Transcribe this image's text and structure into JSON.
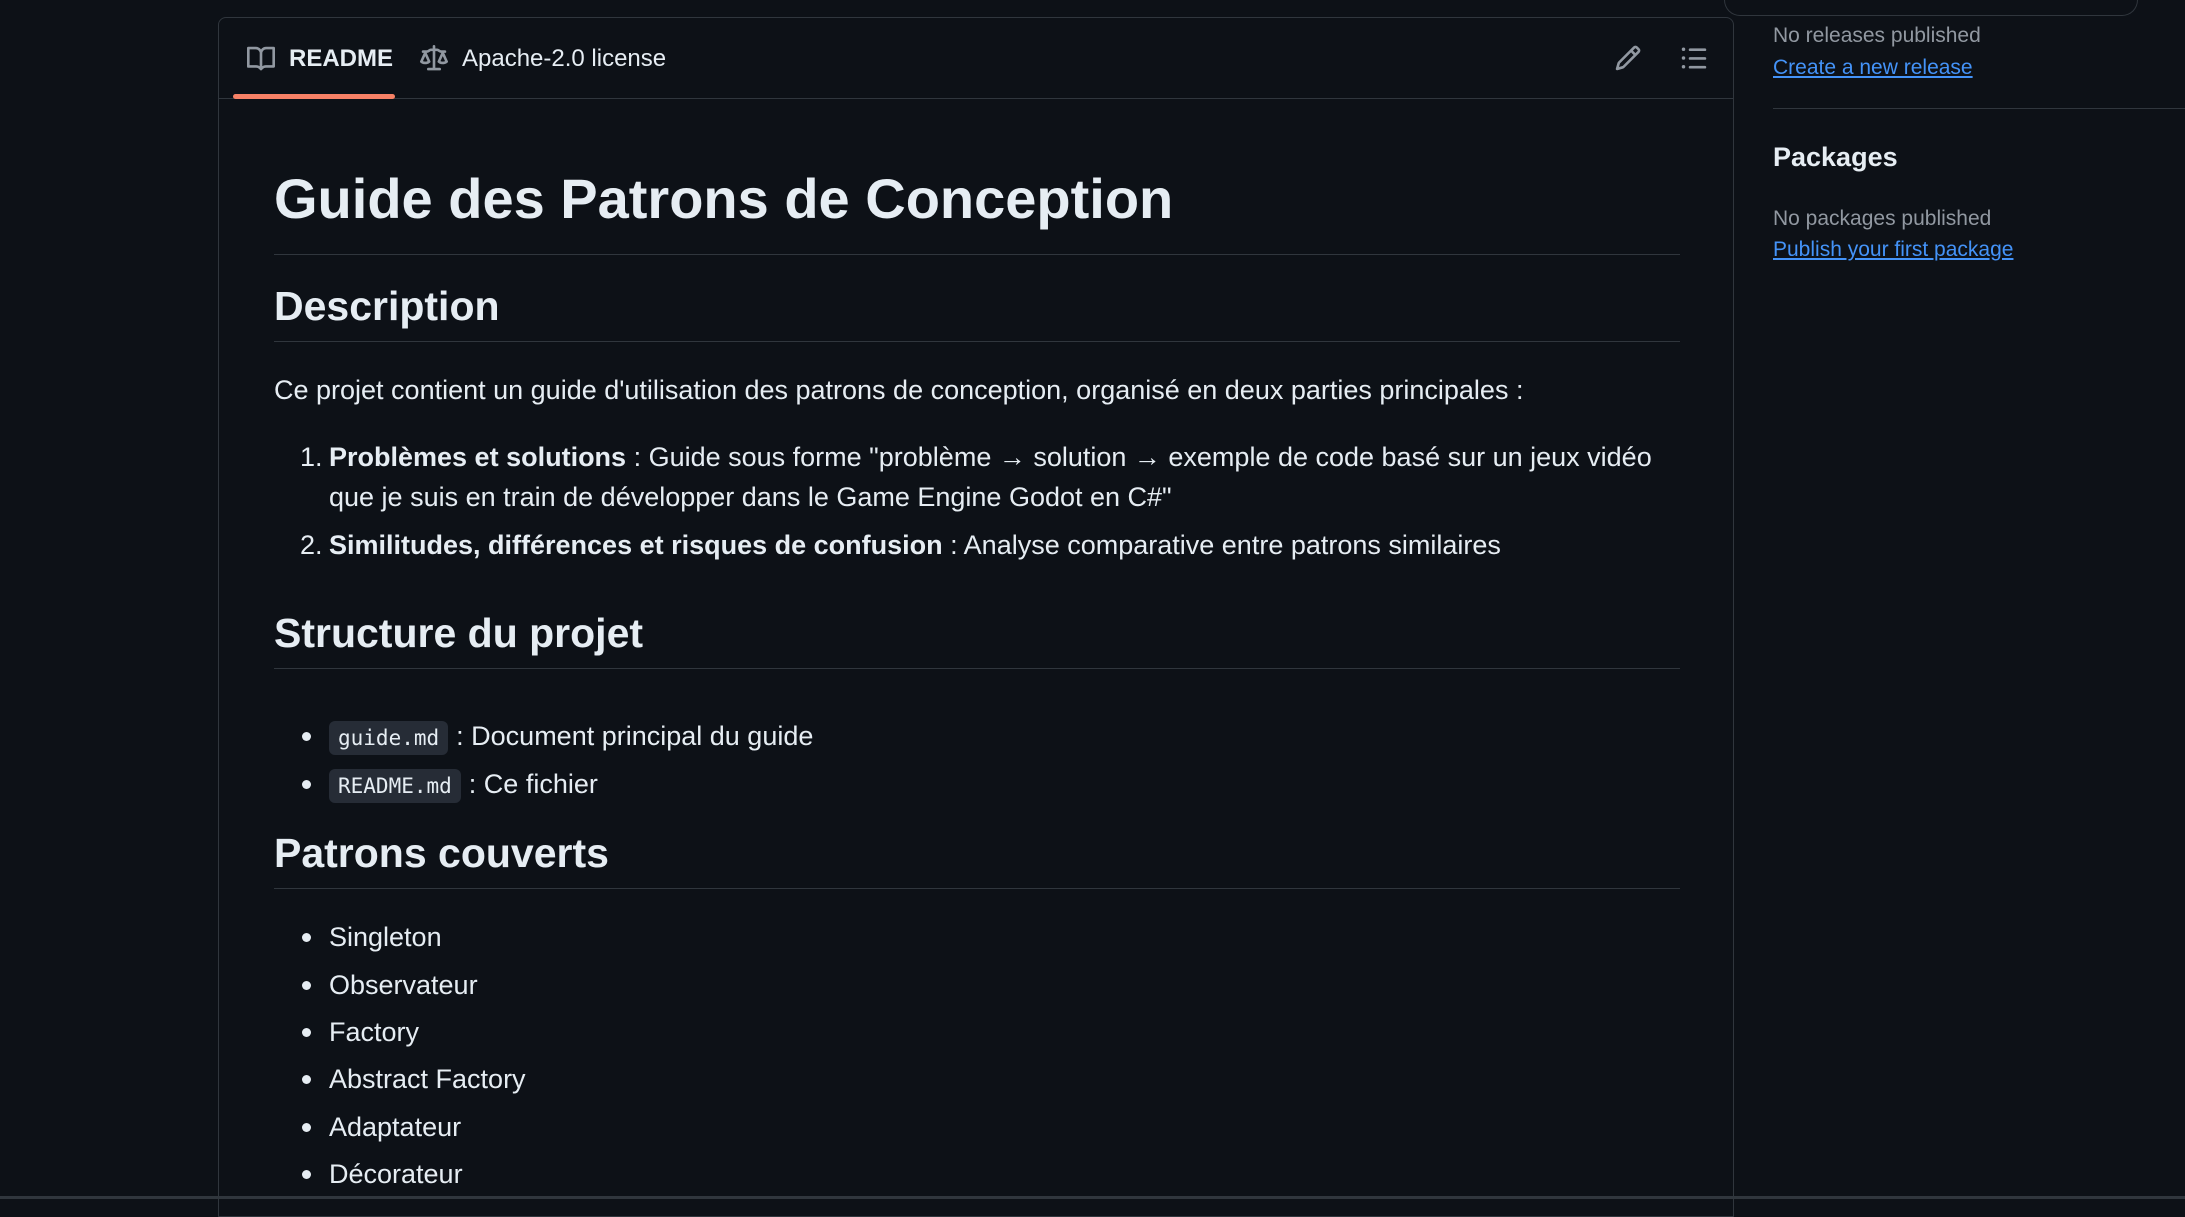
{
  "tabs": {
    "readme": "README",
    "license": "Apache-2.0 license"
  },
  "toolbar": {
    "edit_icon": "pencil-icon",
    "toc_icon": "list-unordered-icon"
  },
  "readme": {
    "title": "Guide des Patrons de Conception",
    "description": {
      "heading": "Description",
      "intro": "Ce projet contient un guide d'utilisation des patrons de conception, organisé en deux parties principales :",
      "items": [
        {
          "number": "1.",
          "bold": "Problèmes et solutions",
          "text": " : Guide sous forme \"problème → solution → exemple de code basé sur un jeux vidéo que je suis en train de développer dans le Game Engine Godot en C#\""
        },
        {
          "number": "2.",
          "bold": "Similitudes, différences et risques de confusion",
          "text": " : Analyse comparative entre patrons similaires"
        }
      ]
    },
    "structure": {
      "heading": "Structure du projet",
      "items": [
        {
          "code": "guide.md",
          "text": ": Document principal du guide"
        },
        {
          "code": "README.md",
          "text": ": Ce fichier"
        }
      ]
    },
    "patterns": {
      "heading": "Patrons couverts",
      "items": [
        "Singleton",
        "Observateur",
        "Factory",
        "Abstract Factory",
        "Adaptateur",
        "Décorateur"
      ]
    }
  },
  "sidebar": {
    "releases": {
      "empty_text": "No releases published",
      "link": "Create a new release"
    },
    "packages": {
      "title": "Packages",
      "empty_text": "No packages published",
      "link": "Publish your first package"
    }
  },
  "colors": {
    "background": "#0d1117",
    "border": "#30363d",
    "text": "#e6edf3",
    "muted": "#9198a1",
    "link": "#4493f8",
    "tab_accent": "#f78166",
    "code_bg": "#262c36"
  }
}
